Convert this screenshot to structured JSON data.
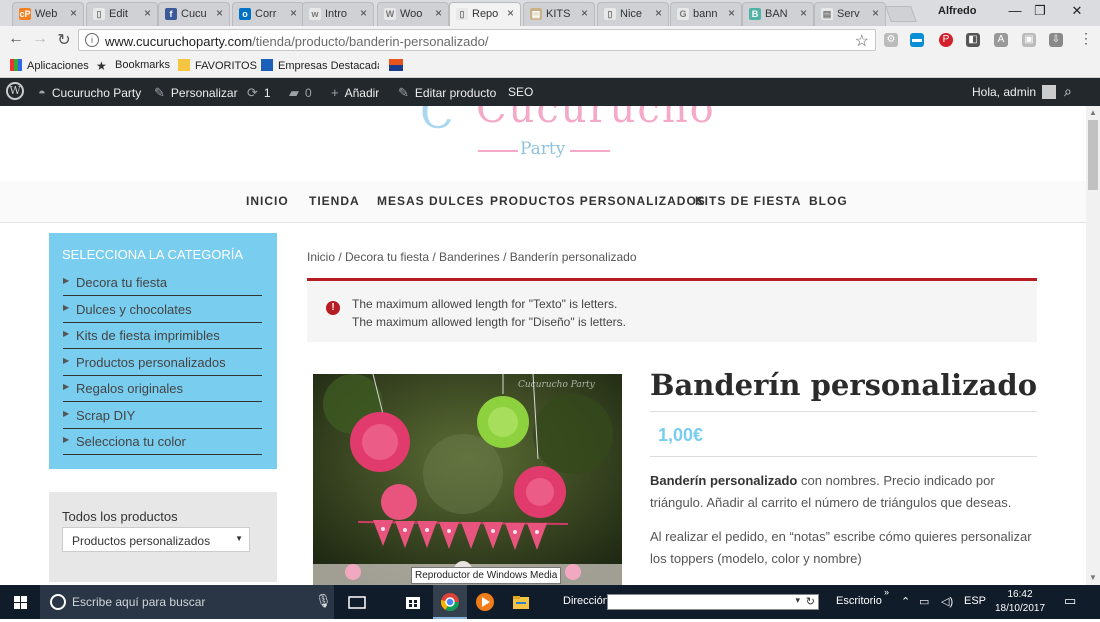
{
  "browser": {
    "tabs": [
      {
        "label": "Web",
        "color": "#f48024",
        "glyph": "cP"
      },
      {
        "label": "Edit",
        "color": "#e8e8e8",
        "glyph": "▯"
      },
      {
        "label": "Cucu",
        "color": "#3b5998",
        "glyph": "f"
      },
      {
        "label": "Corr",
        "color": "#0072c6",
        "glyph": "o"
      },
      {
        "label": "Intro",
        "color": "#e8e8e8",
        "glyph": "w"
      },
      {
        "label": "Woo",
        "color": "#e8e8e8",
        "glyph": "W"
      },
      {
        "label": "Repo",
        "color": "#e8e8e8",
        "glyph": "▯"
      },
      {
        "label": "KITS",
        "color": "#c9b28a",
        "glyph": "▤"
      },
      {
        "label": "Nice",
        "color": "#e8e8e8",
        "glyph": "▯"
      },
      {
        "label": "bann",
        "color": "#e8e8e8",
        "glyph": "G"
      },
      {
        "label": "BAN",
        "color": "#4fb3a6",
        "glyph": "B"
      },
      {
        "label": "Serv",
        "color": "#e8e8e8",
        "glyph": "▤"
      }
    ],
    "profile_name": "Alfredo",
    "url_host": "www.cucuruchoparty.com",
    "url_path": "/tienda/producto/banderin-personalizado/",
    "bookmarks": [
      "Aplicaciones",
      "Bookmarks",
      "FAVORITOS",
      "Empresas Destacadas"
    ]
  },
  "adminbar": {
    "site": "Cucurucho Party",
    "customize": "Personalizar",
    "updates": "1",
    "comments": "0",
    "add": "Añadir",
    "edit": "Editar producto",
    "seo": "SEO",
    "greeting": "Hola, admin"
  },
  "logo": {
    "brand": "Cucurucho",
    "sub": "Party"
  },
  "nav": [
    "INICIO",
    "TIENDA",
    "MESAS DULCES",
    "PRODUCTOS PERSONALIZADOS",
    "KITS DE FIESTA",
    "BLOG"
  ],
  "sidebar": {
    "category_title": "SELECCIONA LA CATEGORÍA",
    "categories": [
      "Decora tu fiesta",
      "Dulces y chocolates",
      "Kits de fiesta imprimibles",
      "Productos personalizados",
      "Regalos originales",
      "Scrap DIY",
      "Selecciona tu color"
    ],
    "all_title": "Todos los productos",
    "all_selected": "Productos personalizados"
  },
  "breadcrumb": "Inicio / Decora tu fiesta / Banderines / Banderín personalizado",
  "notices": [
    "The maximum allowed length for \"Texto\" is letters.",
    "The maximum allowed length for \"Diseño\" is letters."
  ],
  "product": {
    "title": "Banderín personalizado",
    "price": "1,00€",
    "desc_bold": "Banderín personalizado",
    "desc_rest": " con nombres. Precio indicado por",
    "desc_line2": "triángulo. Añadir al carrito el número de triángulos que deseas.",
    "note_line1": "Al realizar el pedido, en “notas” escribe cómo quieres personalizar",
    "note_line2": "los toppers (modelo, color y nombre)",
    "watermark": "Cucurucho Party"
  },
  "tooltip": "Reproductor de Windows Media",
  "taskbar": {
    "search_placeholder": "Escribe aquí para buscar",
    "address_label": "Dirección",
    "desktop": "Escritorio",
    "lang": "ESP",
    "time": "16:42",
    "date": "18/10/2017"
  },
  "colors": {
    "accent": "#79cdee",
    "error": "#b81c23",
    "adminbar": "#23282d"
  }
}
